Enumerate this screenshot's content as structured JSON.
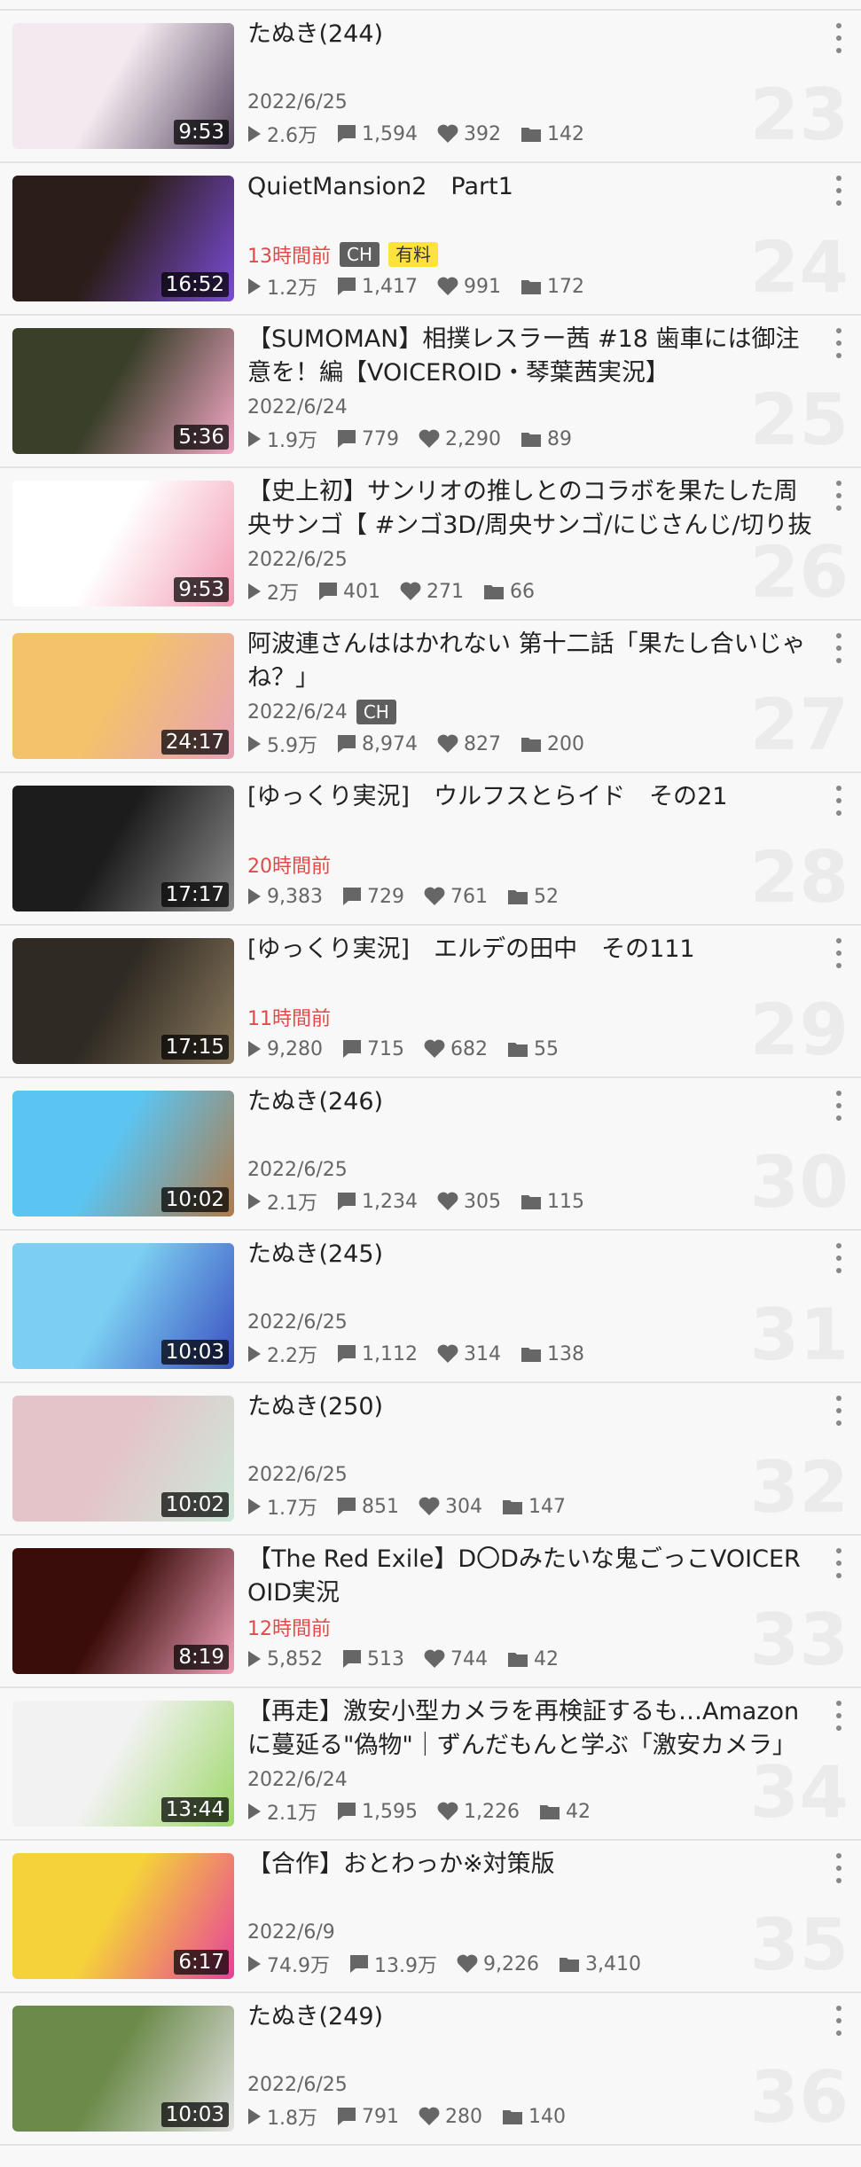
{
  "videos": [
    {
      "title": "たぬき(244)",
      "date": "2022/6/25",
      "recent": false,
      "badges": [],
      "duration": "9:53",
      "views": "2.6万",
      "comments": "1,594",
      "likes": "392",
      "mylists": "142",
      "rank": "23",
      "thumb_colors": [
        "#f3e9ef",
        "#5a4a63"
      ]
    },
    {
      "title": "QuietMansion2　Part1",
      "date": "13時間前",
      "recent": true,
      "badges": [
        {
          "label": "CH",
          "type": "ch"
        },
        {
          "label": "有料",
          "type": "paid"
        }
      ],
      "duration": "16:52",
      "views": "1.2万",
      "comments": "1,417",
      "likes": "991",
      "mylists": "172",
      "rank": "24",
      "thumb_colors": [
        "#2b1d18",
        "#7b4cd8"
      ]
    },
    {
      "title": "【SUMOMAN】相撲レスラー茜 #18 歯車には御注意を！編【VOICEROID・琴葉茜実況】",
      "date": "2022/6/24",
      "recent": false,
      "badges": [],
      "duration": "5:36",
      "views": "1.9万",
      "comments": "779",
      "likes": "2,290",
      "mylists": "89",
      "rank": "25",
      "thumb_colors": [
        "#3a3f2a",
        "#f4a8c6"
      ]
    },
    {
      "title": "【史上初】サンリオの推しとのコラボを果たした周央サンゴ【 #ンゴ3D/周央サンゴ/にじさんじ/切り抜き】",
      "date": "2022/6/25",
      "recent": false,
      "badges": [],
      "duration": "9:53",
      "views": "2万",
      "comments": "401",
      "likes": "271",
      "mylists": "66",
      "rank": "26",
      "thumb_colors": [
        "#ffffff",
        "#f39bb4"
      ]
    },
    {
      "title": "阿波連さんははかれない 第十二話「果たし合いじゃね？」",
      "date": "2022/6/24",
      "recent": false,
      "badges": [
        {
          "label": "CH",
          "type": "ch"
        }
      ],
      "duration": "24:17",
      "views": "5.9万",
      "comments": "8,974",
      "likes": "827",
      "mylists": "200",
      "rank": "27",
      "thumb_colors": [
        "#f2c36a",
        "#e8a1b8"
      ]
    },
    {
      "title": "[ゆっくり実況]　ウルフスとらイド　その21",
      "date": "20時間前",
      "recent": true,
      "badges": [],
      "duration": "17:17",
      "views": "9,383",
      "comments": "729",
      "likes": "761",
      "mylists": "52",
      "rank": "28",
      "thumb_colors": [
        "#1c1c1c",
        "#8a8a8a"
      ]
    },
    {
      "title": "[ゆっくり実況]　エルデの田中　その111",
      "date": "11時間前",
      "recent": true,
      "badges": [],
      "duration": "17:15",
      "views": "9,280",
      "comments": "715",
      "likes": "682",
      "mylists": "55",
      "rank": "29",
      "thumb_colors": [
        "#2f2a23",
        "#8b7a5e"
      ]
    },
    {
      "title": "たぬき(246)",
      "date": "2022/6/25",
      "recent": false,
      "badges": [],
      "duration": "10:02",
      "views": "2.1万",
      "comments": "1,234",
      "likes": "305",
      "mylists": "115",
      "rank": "30",
      "thumb_colors": [
        "#5cc4f0",
        "#b07a4a"
      ]
    },
    {
      "title": "たぬき(245)",
      "date": "2022/6/25",
      "recent": false,
      "badges": [],
      "duration": "10:03",
      "views": "2.2万",
      "comments": "1,112",
      "likes": "314",
      "mylists": "138",
      "rank": "31",
      "thumb_colors": [
        "#7ccff2",
        "#3a4fc0"
      ]
    },
    {
      "title": "たぬき(250)",
      "date": "2022/6/25",
      "recent": false,
      "badges": [],
      "duration": "10:02",
      "views": "1.7万",
      "comments": "851",
      "likes": "304",
      "mylists": "147",
      "rank": "32",
      "thumb_colors": [
        "#e4c4c8",
        "#cde8d8"
      ]
    },
    {
      "title": "【The Red Exile】D〇Dみたいな鬼ごっこVOICEROID実況",
      "date": "12時間前",
      "recent": true,
      "badges": [],
      "duration": "8:19",
      "views": "5,852",
      "comments": "513",
      "likes": "744",
      "mylists": "42",
      "rank": "33",
      "thumb_colors": [
        "#3a0d0a",
        "#f0a0b8"
      ]
    },
    {
      "title": "【再走】激安小型カメラを再検証するも…Amazonに蔓延る\"偽物\"｜ずんだもんと学ぶ「激安カメラ」",
      "date": "2022/6/24",
      "recent": false,
      "badges": [],
      "duration": "13:44",
      "views": "2.1万",
      "comments": "1,595",
      "likes": "1,226",
      "mylists": "42",
      "rank": "34",
      "thumb_colors": [
        "#f2f2f2",
        "#9ed86a"
      ]
    },
    {
      "title": "【合作】おとわっか※対策版",
      "date": "2022/6/9",
      "recent": false,
      "badges": [],
      "duration": "6:17",
      "views": "74.9万",
      "comments": "13.9万",
      "likes": "9,226",
      "mylists": "3,410",
      "rank": "35",
      "thumb_colors": [
        "#f5d23a",
        "#e8409a"
      ]
    },
    {
      "title": "たぬき(249)",
      "date": "2022/6/25",
      "recent": false,
      "badges": [],
      "duration": "10:03",
      "views": "1.8万",
      "comments": "791",
      "likes": "280",
      "mylists": "140",
      "rank": "36",
      "thumb_colors": [
        "#6c8a4a",
        "#e4e4e4"
      ]
    }
  ]
}
